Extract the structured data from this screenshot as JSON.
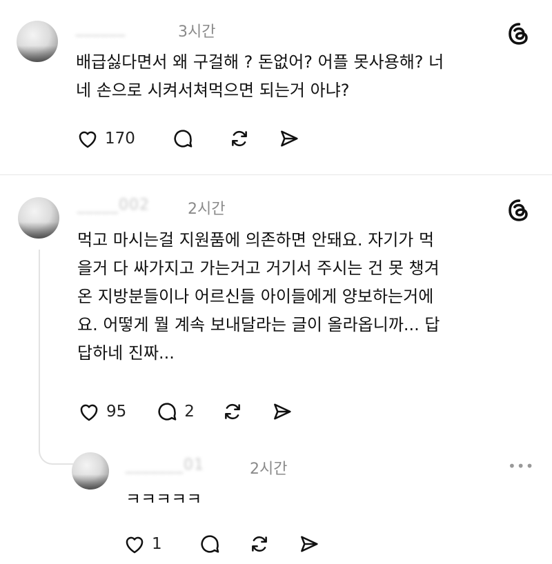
{
  "posts": [
    {
      "username": "______",
      "time": "3시간",
      "text_lines": [
        "배급싫다면서 왜 구걸해 ? 돈없어? 어플 못사용해? 너",
        "네 손으로 시켜서쳐먹으면 되는거 아냐?"
      ],
      "likes": "170",
      "replies": ""
    },
    {
      "username": "_____002",
      "time": "2시간",
      "text_lines": [
        "먹고 마시는걸 지원품에 의존하면 안돼요. 자기가 먹",
        "을거 다 싸가지고 가는거고 거기서 주시는 건 못 챙겨",
        "온 지방분들이나 어르신들 아이들에게 양보하는거에",
        "요. 어떻게 뭘 계속 보내달라는 글이 올라옵니까... 답",
        "답하네 진짜..."
      ],
      "likes": "95",
      "replies": "2"
    },
    {
      "username": "_______01",
      "time": "2시간",
      "text_lines": [
        "ㅋㅋㅋㅋㅋ"
      ],
      "likes": "1",
      "replies": ""
    }
  ],
  "more_menu": "•••",
  "icons": {
    "like": "heart-icon",
    "reply": "comment-icon",
    "repost": "repost-icon",
    "share": "send-icon",
    "brand": "threads-logo-icon"
  }
}
